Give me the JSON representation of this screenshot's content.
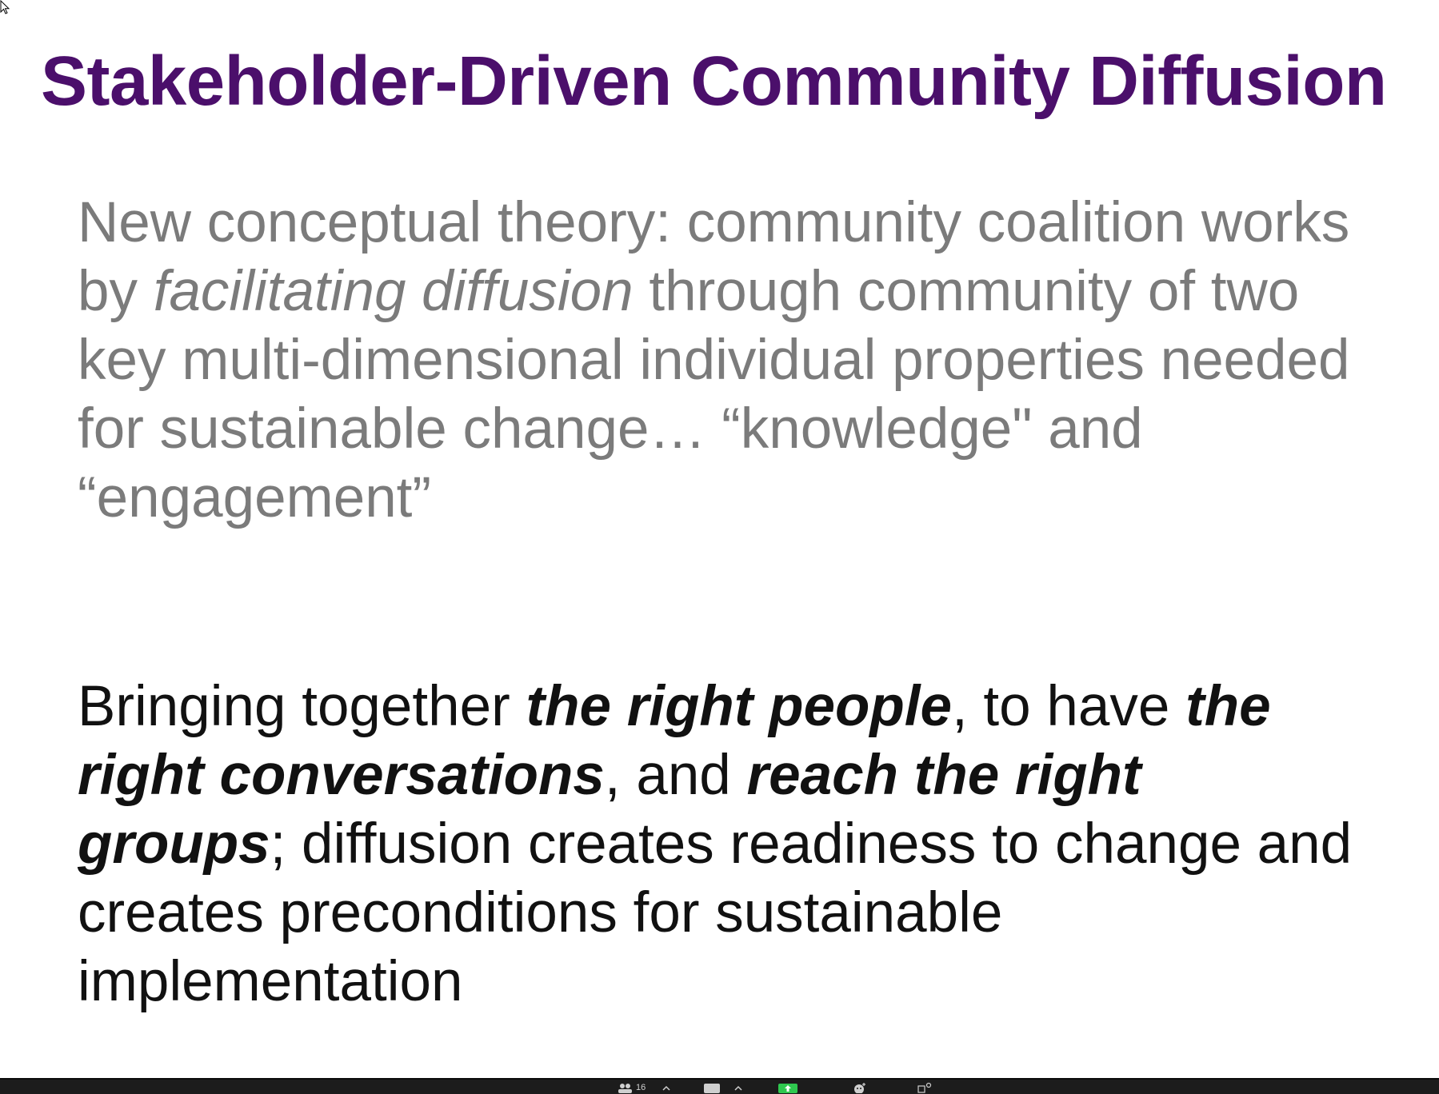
{
  "slide": {
    "title": "Stakeholder-Driven Community Diffusion",
    "paragraph1": {
      "line1": "New conceptual theory: community coalition works",
      "line2_prefix": "by ",
      "line2_emphasis": "facilitating diffusion",
      "line2_suffix": " through community of two",
      "line3": "key multi-dimensional individual properties needed",
      "line4": "for sustainable change… “knowledge\" and",
      "line5": "“engagement”"
    },
    "paragraph2": {
      "seg1": "Bringing together ",
      "seg2_bold": "the right people",
      "seg3": ", to have ",
      "seg4_bold": "the",
      "seg5_bold": "right conversations",
      "seg6": ", and ",
      "seg7_bold": "reach the right",
      "seg8_bold": "groups",
      "seg9": "; diffusion creates readiness to change and",
      "seg10": "creates preconditions for sustainable",
      "seg11": "implementation"
    }
  },
  "meeting_toolbar": {
    "participants_count": "16",
    "icons": [
      "participants-icon",
      "chevron-up-icon",
      "chat-icon",
      "chevron-up-icon",
      "share-screen-icon",
      "reactions-icon",
      "apps-icon"
    ],
    "share_color": "#2fc84f"
  }
}
